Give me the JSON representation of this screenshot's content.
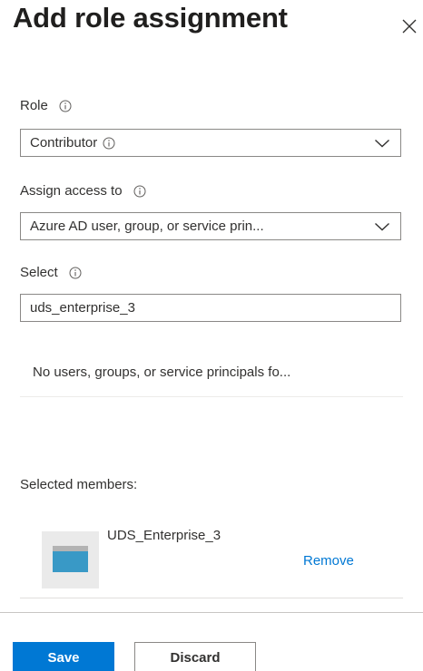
{
  "header": {
    "title": "Add role assignment",
    "close_icon": "close-icon"
  },
  "role": {
    "label": "Role",
    "selected": "Contributor"
  },
  "assign_access": {
    "label": "Assign access to",
    "selected": "Azure AD user, group, or service prin..."
  },
  "select": {
    "label": "Select",
    "value": "uds_enterprise_3"
  },
  "search_results": {
    "empty_message": "No users, groups, or service principals fo..."
  },
  "selected_members": {
    "label": "Selected members:",
    "items": [
      {
        "name": "UDS_Enterprise_3",
        "remove_label": "Remove",
        "icon": "app-window-icon"
      }
    ]
  },
  "footer": {
    "save_label": "Save",
    "discard_label": "Discard"
  },
  "colors": {
    "accent": "#0078d4",
    "text": "#323130",
    "border": "#8a8886"
  }
}
